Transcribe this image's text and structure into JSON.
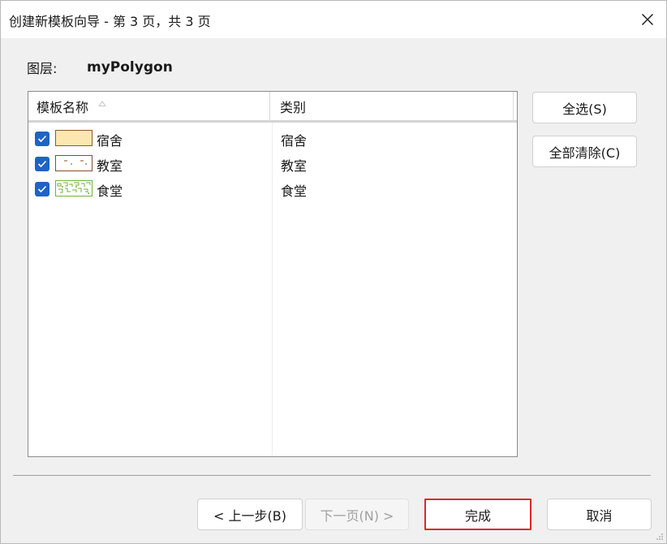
{
  "window": {
    "title": "创建新模板向导 - 第 3 页，共 3 页",
    "close_icon": "close-icon"
  },
  "layer": {
    "label": "图层:",
    "value": "myPolygon"
  },
  "list": {
    "columns": {
      "name": "模板名称",
      "category": "类别"
    },
    "sort_icon": "sort-ascending-icon",
    "rows": [
      {
        "name": "宿舍",
        "category": "宿舍",
        "checked": true,
        "swatch": "solid-tan",
        "fill": "#fde7b0",
        "border": "#8a5a2b"
      },
      {
        "name": "教室",
        "category": "教室",
        "checked": true,
        "swatch": "dashed-brown",
        "fill": "#ffffff",
        "border": "#8a4b2a"
      },
      {
        "name": "食堂",
        "category": "食堂",
        "checked": true,
        "swatch": "green-pattern",
        "fill": "#ffffff",
        "border": "#6fb33a"
      }
    ]
  },
  "buttons": {
    "select_all": "全选(S)",
    "clear_all": "全部清除(C)",
    "back": "< 上一步(B)",
    "next": "下一页(N) >",
    "finish": "完成",
    "cancel": "取消"
  },
  "colors": {
    "checkbox": "#1f63c5",
    "highlight": "#e0262b"
  }
}
